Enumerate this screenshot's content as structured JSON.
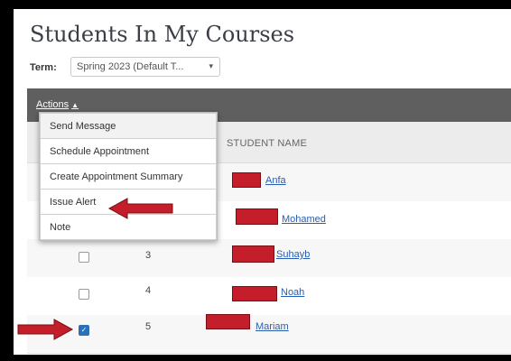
{
  "page": {
    "title": "Students In My Courses",
    "term_label": "Term:",
    "term_value": "Spring 2023 (Default T...",
    "term_chevron": "▾"
  },
  "toolbar": {
    "actions_label": "Actions",
    "actions_caret": "▲"
  },
  "table": {
    "columns": {
      "student_name": "STUDENT NAME"
    },
    "rows": [
      {
        "num": "",
        "name": "Anfa",
        "checked": false
      },
      {
        "num": "",
        "name": "Mohamed",
        "checked": false
      },
      {
        "num": "3",
        "name": "Suhayb",
        "checked": false
      },
      {
        "num": "4",
        "name": "Noah",
        "checked": false
      },
      {
        "num": "5",
        "name": "Mariam",
        "checked": true
      }
    ]
  },
  "actions_menu": {
    "items": [
      "Send Message",
      "Schedule Appointment",
      "Create Appointment Summary",
      "Issue Alert",
      "Note"
    ]
  },
  "colors": {
    "toolbar": "#5f5f5f",
    "redaction": "#c41e2b",
    "link": "#2a5db0",
    "checkbox_checked": "#2a6fb8"
  }
}
